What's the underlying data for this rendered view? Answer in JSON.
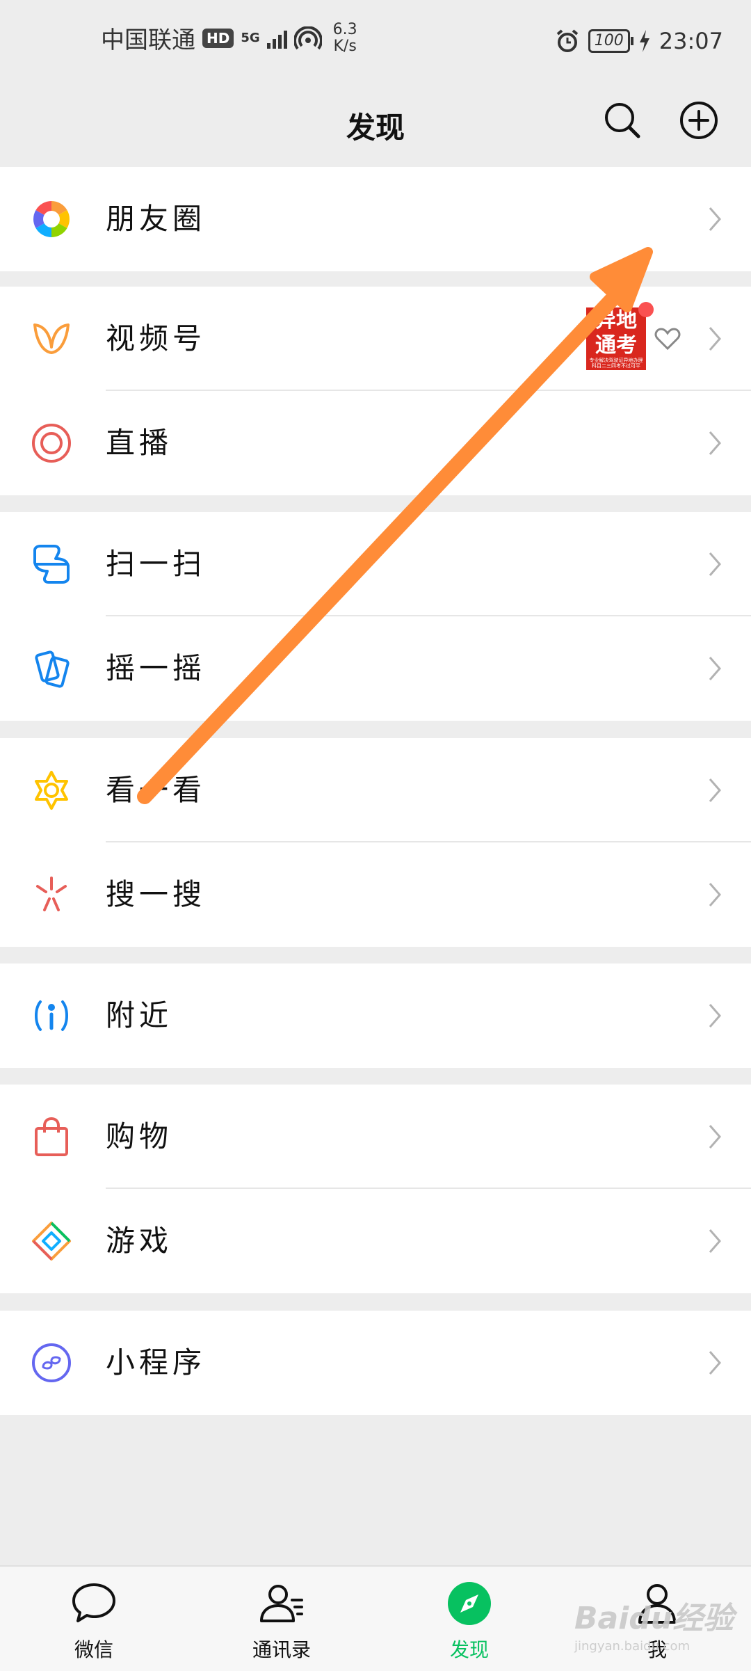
{
  "status_bar": {
    "carrier": "中国联通",
    "hd": "HD",
    "network": "5G",
    "speed_value": "6.3",
    "speed_unit": "K/s",
    "battery": "100",
    "time": "23:07"
  },
  "header": {
    "title": "发现"
  },
  "menu": {
    "moments": "朋友圈",
    "channels": "视频号",
    "live": "直播",
    "scan": "扫一扫",
    "shake": "摇一摇",
    "top_stories": "看一看",
    "search": "搜一搜",
    "nearby": "附近",
    "shopping": "购物",
    "games": "游戏",
    "mini_programs": "小程序"
  },
  "channels_thumb": {
    "line1": "异地",
    "line2": "通考",
    "line3": "专业解决驾驶证异地办理 科目二三四考不过可平"
  },
  "tabs": {
    "chats": "微信",
    "contacts": "通讯录",
    "discover": "发现",
    "me": "我"
  },
  "watermark": {
    "brand": "Baidu经验",
    "url": "jingyan.baidu.com"
  },
  "colors": {
    "accent_green": "#07c160",
    "annotation_arrow": "#ff8c38",
    "badge_red": "#fa5151"
  }
}
